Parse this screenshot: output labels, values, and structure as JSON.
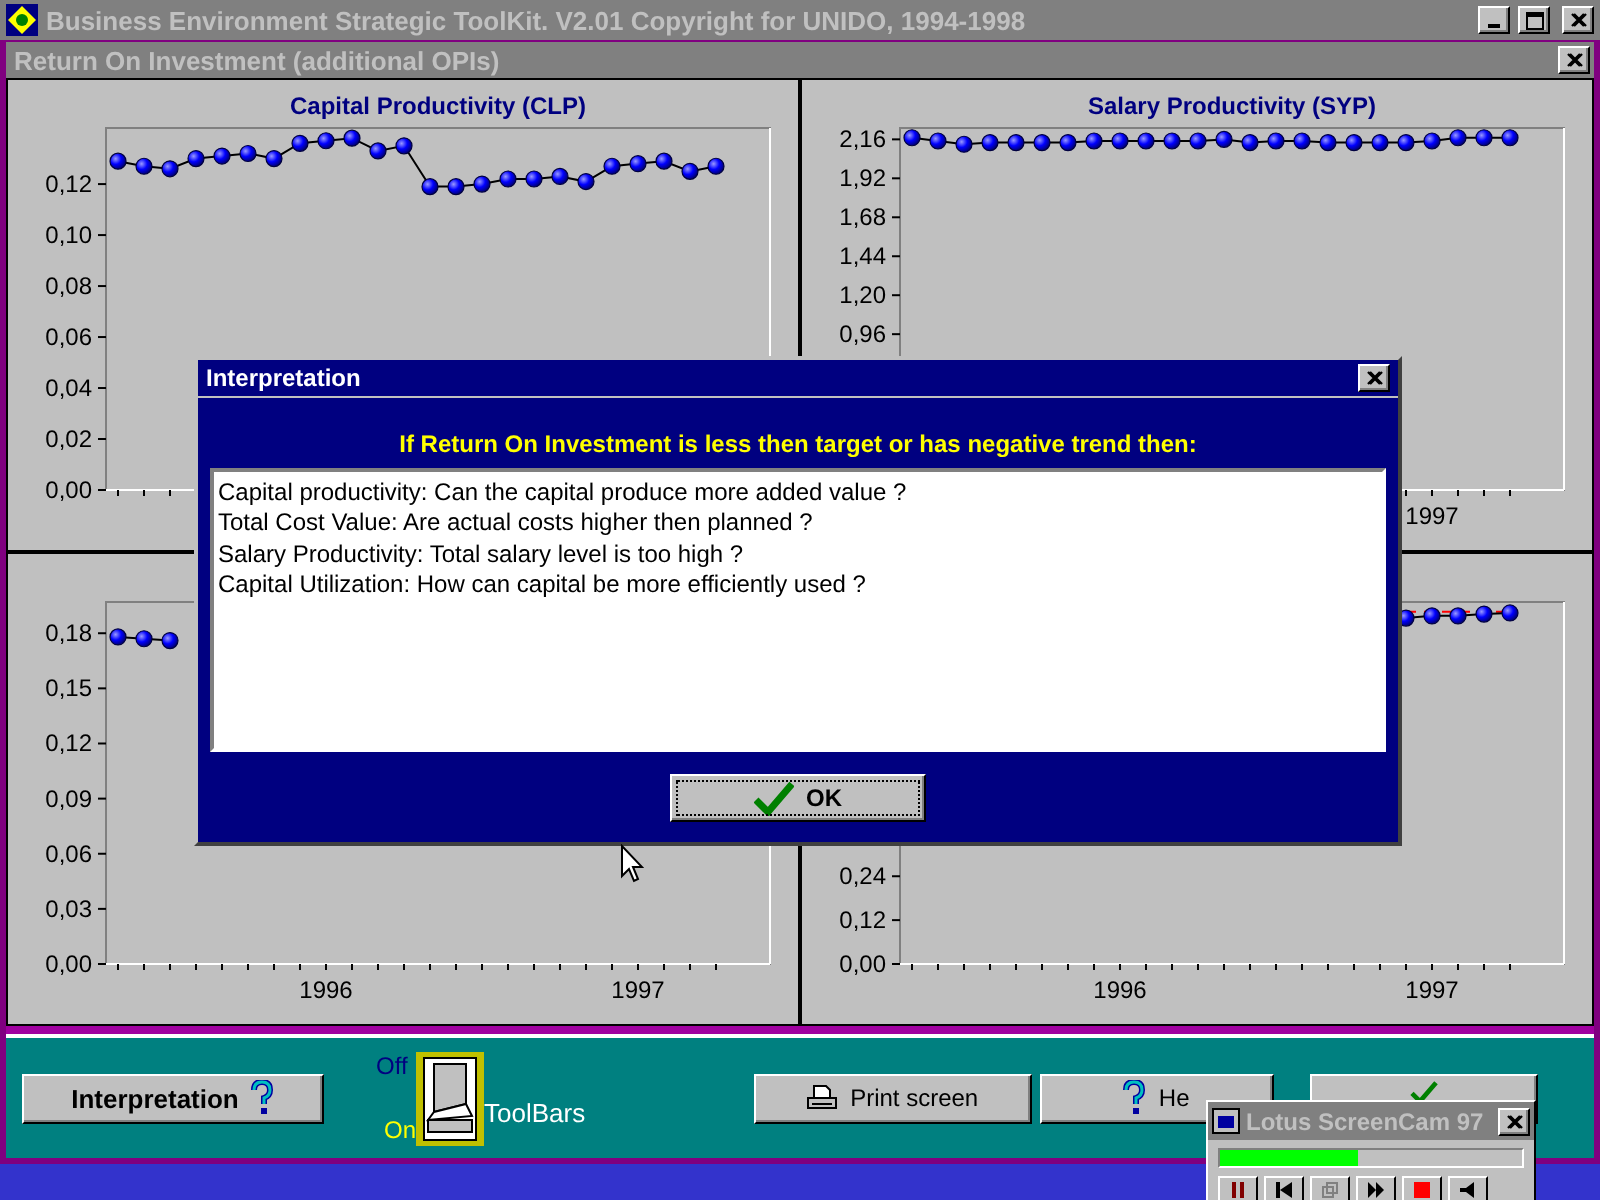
{
  "window": {
    "title": "Business Environment Strategic ToolKit. V2.01 Copyright for UNIDO, 1994-1998"
  },
  "document_window": {
    "title": "Return On Investment (additional OPIs)"
  },
  "charts": [
    {
      "chart_data": {
        "type": "line",
        "title": "Capital Productivity (CLP)",
        "categories": [
          null,
          null,
          null,
          null,
          null,
          null,
          null,
          null,
          null,
          null,
          null,
          null,
          null,
          null,
          null,
          null,
          null,
          null,
          null,
          null,
          null,
          null,
          null,
          null
        ],
        "ylim": [
          0,
          0.142
        ],
        "yticks": [
          {
            "value": 0,
            "label": "0,00"
          },
          {
            "value": 0.02,
            "label": "0,02"
          },
          {
            "value": 0.04,
            "label": "0,04"
          },
          {
            "value": 0.06,
            "label": "0,06"
          },
          {
            "value": 0.08,
            "label": "0,08"
          },
          {
            "value": 0.1,
            "label": "0,10"
          },
          {
            "value": 0.12,
            "label": "0,12"
          }
        ],
        "series": [
          {
            "color": "#000000",
            "marker": "circle",
            "values": [
              0.129,
              0.127,
              0.126,
              0.13,
              0.131,
              0.132,
              0.13,
              0.136,
              0.137,
              0.138,
              0.133,
              0.135,
              0.119,
              0.119,
              0.12,
              0.122,
              0.122,
              0.123,
              0.121,
              0.127,
              0.128,
              0.129,
              0.125,
              0.127
            ]
          }
        ]
      }
    },
    {
      "chart_data": {
        "type": "line",
        "title": "Salary Productivity (SYP)",
        "categories": [
          null,
          null,
          null,
          null,
          null,
          null,
          null,
          null,
          null,
          null,
          null,
          null,
          null,
          null,
          null,
          null,
          null,
          null,
          null,
          null,
          "1997",
          null,
          null,
          null
        ],
        "ylim": [
          0,
          2.23
        ],
        "yticks": [
          {
            "value": 0.96,
            "label": "0,96"
          },
          {
            "value": 1.2,
            "label": "1,20"
          },
          {
            "value": 1.44,
            "label": "1,44"
          },
          {
            "value": 1.68,
            "label": "1,68"
          },
          {
            "value": 1.92,
            "label": "1,92"
          },
          {
            "value": 2.16,
            "label": "2,16"
          }
        ],
        "series": [
          {
            "color": "#000000",
            "marker": "circle",
            "values": [
              2.17,
              2.15,
              2.13,
              2.14,
              2.14,
              2.14,
              2.14,
              2.15,
              2.15,
              2.15,
              2.15,
              2.15,
              2.16,
              2.14,
              2.15,
              2.15,
              2.14,
              2.14,
              2.14,
              2.14,
              2.15,
              2.17,
              2.17,
              2.17
            ]
          }
        ]
      }
    },
    {
      "chart_data": {
        "type": "line",
        "categories": [
          null,
          null,
          null,
          null,
          null,
          null,
          null,
          null,
          "1996",
          null,
          null,
          null,
          null,
          null,
          null,
          null,
          null,
          null,
          null,
          null,
          "1997",
          null,
          null,
          null
        ],
        "ylim": [
          0,
          0.197
        ],
        "yticks": [
          {
            "value": 0,
            "label": "0,00"
          },
          {
            "value": 0.03,
            "label": "0,03"
          },
          {
            "value": 0.06,
            "label": "0,06"
          },
          {
            "value": 0.09,
            "label": "0,09"
          },
          {
            "value": 0.12,
            "label": "0,12"
          },
          {
            "value": 0.15,
            "label": "0,15"
          },
          {
            "value": 0.18,
            "label": "0,18"
          }
        ],
        "series": [
          {
            "color": "#000000",
            "marker": "circle",
            "values": [
              0.178,
              0.177,
              0.176,
              null,
              null,
              null,
              null,
              null,
              null,
              null,
              null,
              null,
              null,
              null,
              null,
              null,
              null,
              null,
              null,
              null,
              null,
              null,
              null,
              null
            ]
          }
        ]
      }
    },
    {
      "chart_data": {
        "type": "line",
        "categories": [
          null,
          null,
          null,
          null,
          null,
          null,
          null,
          null,
          "1996",
          null,
          null,
          null,
          null,
          null,
          null,
          null,
          null,
          null,
          null,
          null,
          "1997",
          null,
          null,
          null
        ],
        "ylim": [
          0,
          0.99
        ],
        "yticks": [
          {
            "value": 0,
            "label": "0,00"
          },
          {
            "value": 0.12,
            "label": "0,12"
          },
          {
            "value": 0.24,
            "label": "0,24"
          }
        ],
        "series": [
          {
            "color": "#000000",
            "marker": "circle",
            "values": [
              null,
              null,
              null,
              null,
              null,
              null,
              null,
              null,
              null,
              null,
              null,
              null,
              null,
              null,
              null,
              null,
              null,
              null,
              null,
              0.946,
              0.952,
              0.952,
              0.957,
              0.96
            ]
          },
          {
            "color": "#ff0000",
            "line_style": "dashed",
            "values": [
              null,
              null,
              null,
              null,
              null,
              null,
              null,
              null,
              null,
              null,
              null,
              null,
              null,
              null,
              null,
              null,
              null,
              null,
              null,
              0.963,
              0.963,
              0.963,
              0.963,
              0.963
            ]
          }
        ]
      }
    }
  ],
  "toolbar": {
    "interpretation_button": "Interpretation",
    "switch": {
      "off_label": "Off",
      "on_label": "On",
      "on": true,
      "label": "ToolBars"
    },
    "buttons": [
      {
        "kind": "printer",
        "label": "Print screen"
      },
      {
        "kind": "help",
        "label": "He"
      },
      {
        "kind": "check"
      }
    ]
  },
  "dialog": {
    "title": "Interpretation",
    "heading": "If Return On Investment is less then target or has negative trend then:",
    "lines": [
      "Capital productivity: Can the capital produce more added value ?",
      "Total Cost Value: Are actual costs higher then planned ?",
      "Salary Productivity: Total salary level is too high ?",
      "Capital Utilization: How can capital be more efficiently used ?"
    ],
    "ok_button": "OK"
  },
  "recorder": {
    "title": "Lotus ScreenCam 97",
    "level": 0.46
  }
}
